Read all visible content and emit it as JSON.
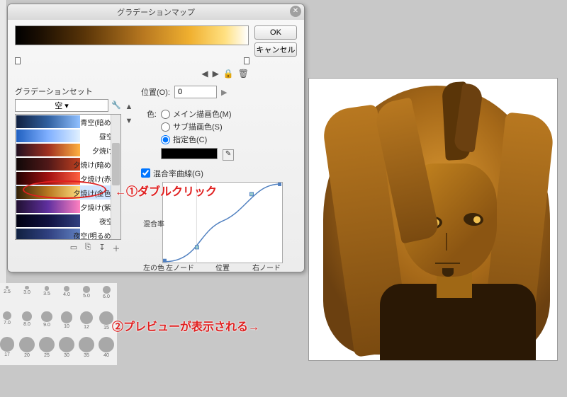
{
  "dialog": {
    "title": "グラデーションマップ",
    "ok": "OK",
    "cancel": "キャンセル",
    "gradient_set_label": "グラデーションセット",
    "gradient_set_value": "空",
    "position_label": "位置(O):",
    "position_value": "0",
    "color_label": "色:",
    "radio_main": "メイン描画色(M)",
    "radio_sub": "サブ描画色(S)",
    "radio_custom": "指定色(C)",
    "curve_check": "混合率曲線(G)",
    "curve_ylabel": "混合率",
    "curve_xlabel_left": "左の色",
    "curve_x_left": "左ノード",
    "curve_x_mid": "位置",
    "curve_x_right": "右ノード",
    "gradients": [
      {
        "name": "青空(暗め)",
        "css": "linear-gradient(90deg,#102040,#3060a0,#90c0ff)"
      },
      {
        "name": "昼空",
        "css": "linear-gradient(90deg,#2060c0,#80b0ff,#e0f0ff)"
      },
      {
        "name": "夕焼け",
        "css": "linear-gradient(90deg,#201020,#a03020,#ffb040)"
      },
      {
        "name": "夕焼け(暗め)",
        "css": "linear-gradient(90deg,#100808,#501818,#c04020)"
      },
      {
        "name": "夕焼け(赤)",
        "css": "linear-gradient(90deg,#200000,#a01010,#ff6040)"
      },
      {
        "name": "夕焼け(金色)",
        "css": "linear-gradient(90deg,#302008,#b87820,#ffe080)"
      },
      {
        "name": "夕焼け(紫)",
        "css": "linear-gradient(90deg,#201030,#6030a0,#ff80c0)"
      },
      {
        "name": "夜空",
        "css": "linear-gradient(90deg,#000010,#101040,#304080)"
      },
      {
        "name": "夜空(明るめ)",
        "css": "linear-gradient(90deg,#102040,#304080,#6080c0)"
      }
    ],
    "selected_gradient": 5
  },
  "brush_sizes": [
    "2.5",
    "3.0",
    "3.5",
    "4.0",
    "5.0",
    "6.0",
    "7.0",
    "8.0",
    "9.0",
    "10",
    "12",
    "15",
    "17",
    "20",
    "25",
    "30",
    "35",
    "40"
  ],
  "annotations": {
    "a1": "←①ダブルクリック",
    "a2": "②プレビューが表示される→"
  }
}
